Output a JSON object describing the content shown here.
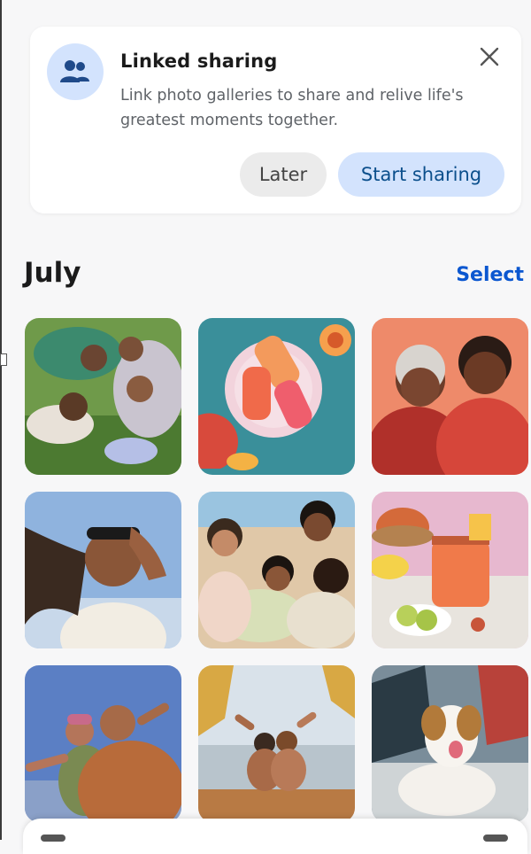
{
  "banner": {
    "title": "Linked sharing",
    "description": "Link photo galleries to share and relive life's greatest moments together.",
    "later_label": "Later",
    "start_label": "Start sharing",
    "icon": "people-icon",
    "close_icon": "close-icon"
  },
  "section": {
    "month": "July",
    "select_label": "Select"
  },
  "colors": {
    "accent": "#0b57d0",
    "chip_blue": "#d3e3fd",
    "background": "#f7f7f8"
  }
}
